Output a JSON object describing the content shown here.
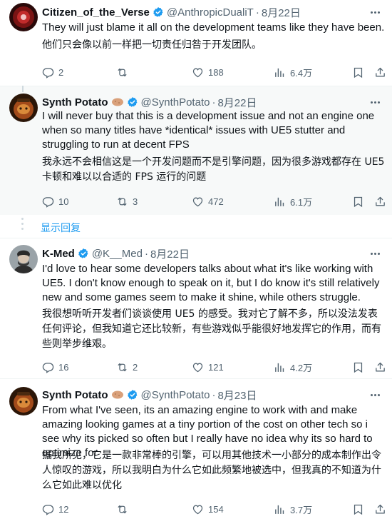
{
  "tweets": [
    {
      "name": "Citizen_of_the_Verse",
      "handle": "@AnthropicDualiT",
      "dot": "·",
      "date": "8月22日",
      "text": "They will just blame it all on the development teams like they have been.",
      "translation": "他们只会像以前一样把一切责任归咎于开发团队。",
      "replies": "2",
      "reposts": "",
      "likes": "188",
      "views": "6.4万"
    },
    {
      "name": "Synth Potato",
      "handle": "@SynthPotato",
      "dot": "·",
      "date": "8月22日",
      "text": "I will never buy that this is a development issue and not an engine one when so many titles have *identical* issues with UE5 stutter and struggling to run at decent FPS",
      "translation": "我永远不会相信这是一个开发问题而不是引擎问题，因为很多游戏都存在 UE5 卡顿和难以以合适的 FPS 运行的问题",
      "replies": "10",
      "reposts": "3",
      "likes": "472",
      "views": "6.1万"
    },
    {
      "name": "K-Med",
      "handle": "@K__Med",
      "dot": "·",
      "date": "8月22日",
      "text": "I'd love to hear some developers talks about what it's like working with UE5. I don't know enough to speak on it, but I do know it's still relatively new and some games seem to make it shine, while others struggle.",
      "translation": "我很想听听开发者们谈谈使用 UE5 的感受。我对它了解不多，所以没法发表任何评论，但我知道它还比较新，有些游戏似乎能很好地发挥它的作用，而有些则举步维艰。",
      "replies": "16",
      "reposts": "2",
      "likes": "121",
      "views": "4.2万"
    },
    {
      "name": "Synth Potato",
      "handle": "@SynthPotato",
      "dot": "·",
      "date": "8月23日",
      "text": "From what I've seen, its an amazing engine to work with and make amazing looking games at a tiny portion of the cost on other tech so i see why its picked so often but I really have no idea why its so hard to optimize for",
      "translation": "据我所见，它是一款非常棒的引擎，可以用其他技术一小部分的成本制作出令人惊叹的游戏，所以我明白为什么它如此频繁地被选中，但我真的不知道为什么它如此难以优化",
      "replies": "12",
      "reposts": "",
      "likes": "154",
      "views": "3.7万"
    }
  ],
  "show_replies": "显示回复",
  "icons": {
    "reply": "reply-icon",
    "repost": "repost-icon",
    "like": "like-icon",
    "views": "views-icon",
    "bookmark": "bookmark-icon",
    "share": "share-icon",
    "verified": "verified-badge-icon",
    "more": "more-icon"
  },
  "colors": {
    "accent": "#1d9bf0",
    "secondary_text": "#536471",
    "highlight_bg": "#f7f9f9"
  }
}
